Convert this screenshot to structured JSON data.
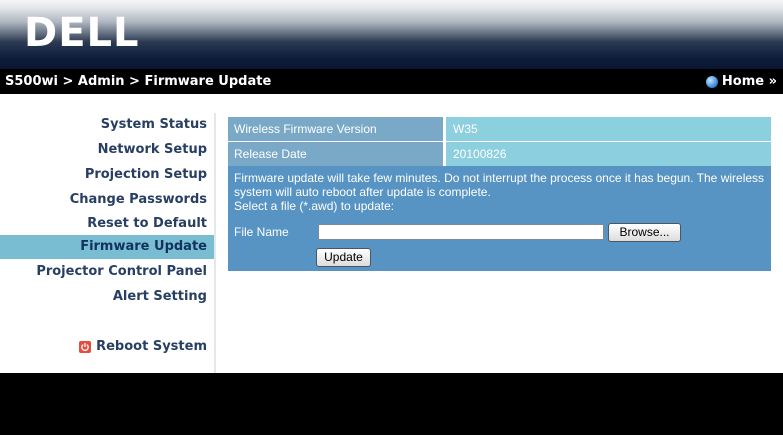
{
  "header": {
    "logo_text": "DELL"
  },
  "topbar": {
    "breadcrumb": "S500wi > Admin > Firmware Update",
    "home_label": "Home »"
  },
  "sidebar": {
    "items": [
      {
        "label": "System Status"
      },
      {
        "label": "Network Setup"
      },
      {
        "label": "Projection Setup"
      },
      {
        "label": "Change Passwords"
      },
      {
        "label": "Reset to Default"
      },
      {
        "label": "Firmware Update",
        "active": true
      },
      {
        "label": "Projector Control Panel"
      },
      {
        "label": "Alert Setting"
      }
    ],
    "reboot_label": "Reboot System"
  },
  "firmware": {
    "version_label": "Wireless Firmware Version",
    "version_value": "W35",
    "release_label": "Release Date",
    "release_value": "20100826",
    "notice": "Firmware update will take few minutes. Do not interrupt the process once it has begun. The wireless system will auto reboot after update is complete.",
    "select_hint": "Select a file (*.awd) to update:",
    "file_label": "File Name",
    "file_value": "",
    "browse_label": "Browse...",
    "update_label": "Update"
  },
  "colors": {
    "accent_active": "#79bdd3",
    "label_cell": "#7aa9c7",
    "value_cell": "#8ccfdf",
    "panel": "#5894c3",
    "nav_text": "#283f63"
  }
}
